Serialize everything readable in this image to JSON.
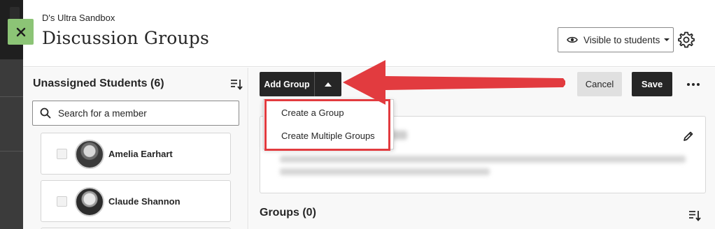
{
  "header": {
    "course_name": "D's Ultra Sandbox",
    "title": "Discussion Groups",
    "visibility_label": "Visible to students"
  },
  "left_panel": {
    "title": "Unassigned Students (6)",
    "search": {
      "placeholder": "Search for a member"
    },
    "members": [
      {
        "name": "Amelia Earhart"
      },
      {
        "name": "Claude Shannon"
      }
    ]
  },
  "toolbar": {
    "add_group_label": "Add Group",
    "cancel_label": "Cancel",
    "save_label": "Save"
  },
  "dropdown": {
    "items": [
      {
        "label": "Create a Group"
      },
      {
        "label": "Create Multiple Groups"
      }
    ]
  },
  "groups": {
    "title": "Groups (0)"
  },
  "colors": {
    "accent_dark": "#262626",
    "close_green": "#8cc476",
    "annotation_red": "#e23b3f"
  }
}
